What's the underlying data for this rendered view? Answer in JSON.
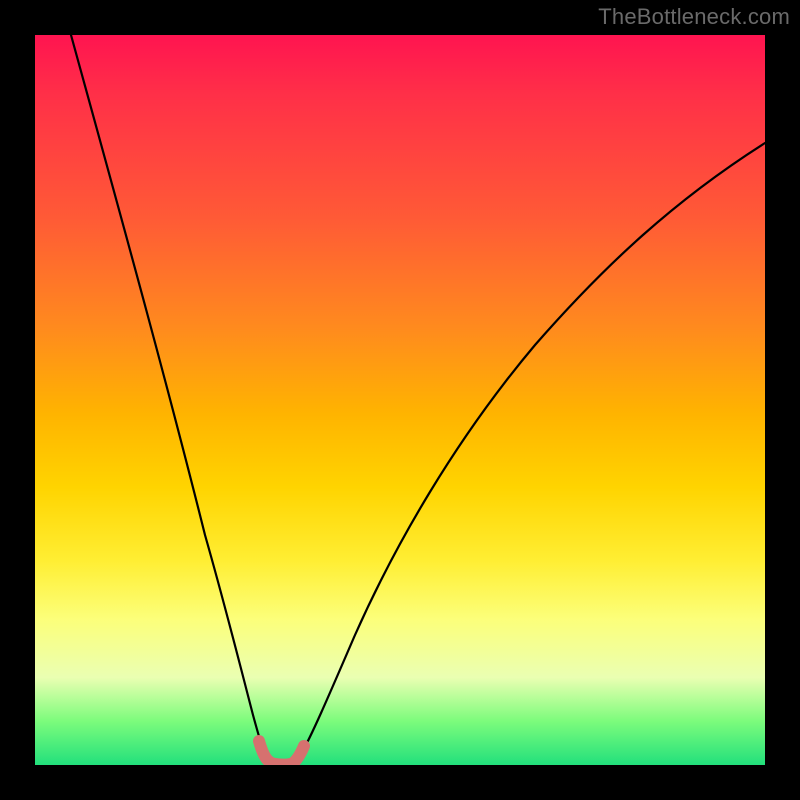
{
  "watermark": "TheBottleneck.com",
  "colors": {
    "frame": "#000000",
    "watermark_text": "#6a6a6a",
    "curve": "#000000",
    "highlight": "#d6716f",
    "gradient_stops": [
      "#ff1450",
      "#ff2f48",
      "#ff5a36",
      "#ff8a1e",
      "#ffb400",
      "#ffd400",
      "#ffee33",
      "#fcff7a",
      "#eaffb2",
      "#7cfc7c",
      "#22e07c"
    ]
  },
  "chart_data": {
    "type": "line",
    "title": "",
    "xlabel": "",
    "ylabel": "",
    "xlim": [
      0,
      100
    ],
    "ylim": [
      0,
      100
    ],
    "grid": false,
    "legend": false,
    "series": [
      {
        "name": "bottleneck-curve",
        "x": [
          5,
          10,
          15,
          20,
          22,
          24,
          26,
          28,
          30,
          31,
          32,
          33,
          34,
          36,
          38,
          40,
          45,
          50,
          55,
          60,
          65,
          70,
          75,
          80,
          85,
          90,
          95,
          100
        ],
        "y": [
          100,
          82,
          62,
          40,
          30,
          21,
          13,
          6,
          2,
          0.5,
          0,
          0,
          0.5,
          3,
          8,
          14,
          28,
          40,
          50,
          58,
          65,
          70,
          75,
          79,
          82,
          85,
          87,
          89
        ]
      }
    ],
    "background_meaning": "heatmap-gradient (red = high bottleneck, green = no bottleneck)",
    "optimal_range_x": [
      29,
      35
    ],
    "optimal_range_y": [
      0,
      4
    ],
    "highlight_label": "optimal-region"
  }
}
